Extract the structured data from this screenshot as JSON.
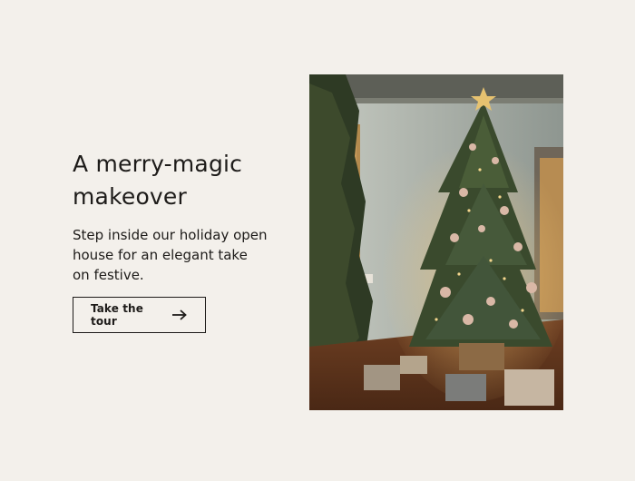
{
  "promo": {
    "headline": "A merry-magic makeover",
    "body": "Step inside our holiday open house for an elegant take on festive.",
    "cta": {
      "label": "Take the tour",
      "icon": "arrow-right-icon"
    },
    "image": {
      "alt": "Christmas tree"
    }
  },
  "colors": {
    "background": "#f3f0eb",
    "text": "#1d1b19"
  }
}
